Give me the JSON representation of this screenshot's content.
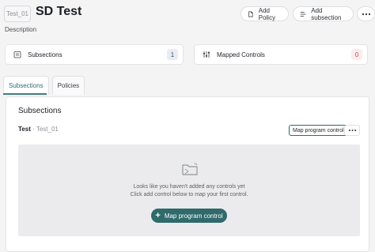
{
  "header": {
    "code_badge": "Test_01",
    "title": "SD Test",
    "description_label": "Description",
    "add_policy": "Add Policy",
    "add_subsection": "Add subsection"
  },
  "stats": {
    "subsections_label": "Subsections",
    "subsections_count": "1",
    "mapped_label": "Mapped Controls",
    "mapped_count": "0"
  },
  "tabs": [
    {
      "label": "Subsections",
      "active": true
    },
    {
      "label": "Policies",
      "active": false
    }
  ],
  "panel": {
    "title": "Subsections",
    "subsection": {
      "name": "Test",
      "separator": "·",
      "code": "Test_01",
      "map_button": "Map program control"
    },
    "empty": {
      "line1": "Looks like you haven't added any controls yet",
      "line2": "Click add control below to map your first control.",
      "button": "Map program control"
    }
  },
  "colors": {
    "accent": "#2f6a6c",
    "count_red_text": "#c24a57",
    "count_red_bg": "#fbecee"
  }
}
